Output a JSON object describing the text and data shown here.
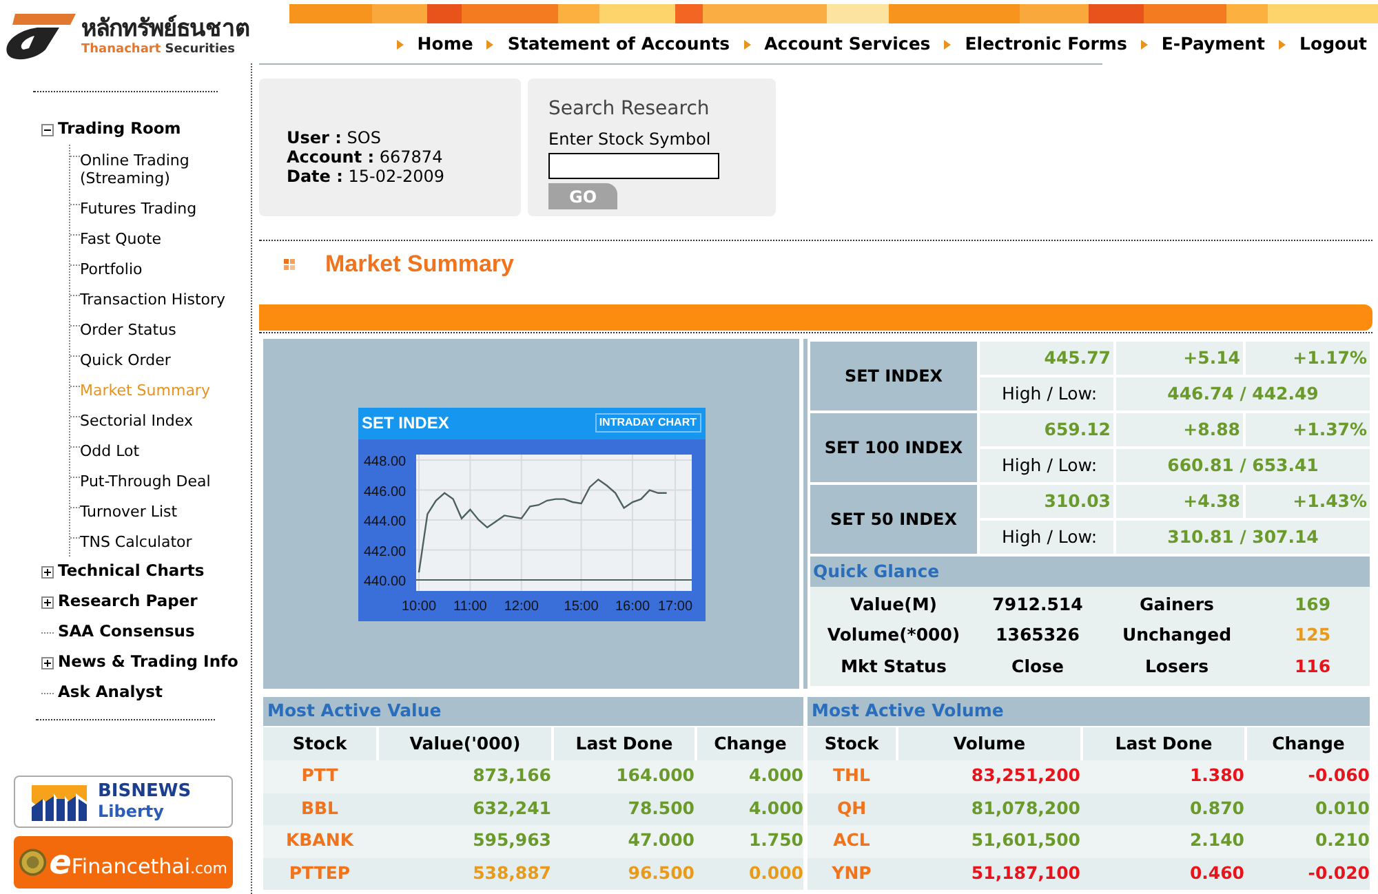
{
  "logo": {
    "thai": "หลักทรัพย์ธนชาต",
    "brand": "Thanachart",
    "suffix": "Securities"
  },
  "nav": [
    "Home",
    "Statement of Accounts",
    "Account Services",
    "Electronic Forms",
    "E-Payment",
    "Logout"
  ],
  "sidebar": {
    "items": [
      {
        "label": "Trading Room",
        "kind": "folder",
        "expanded": true,
        "children": [
          {
            "label": "Online Trading (Streaming)",
            "selected": false
          },
          {
            "label": "Futures Trading",
            "selected": false
          },
          {
            "label": "Fast Quote",
            "selected": false
          },
          {
            "label": "Portfolio",
            "selected": false
          },
          {
            "label": "Transaction History",
            "selected": false
          },
          {
            "label": "Order Status",
            "selected": false
          },
          {
            "label": "Quick Order",
            "selected": false
          },
          {
            "label": "Market Summary",
            "selected": true
          },
          {
            "label": "Sectorial Index",
            "selected": false
          },
          {
            "label": "Odd Lot",
            "selected": false
          },
          {
            "label": "Put-Through Deal",
            "selected": false
          },
          {
            "label": "Turnover List",
            "selected": false
          },
          {
            "label": "TNS Calculator",
            "selected": false
          }
        ]
      },
      {
        "label": "Technical Charts",
        "kind": "folder",
        "expanded": false
      },
      {
        "label": "Research Paper",
        "kind": "folder",
        "expanded": false
      },
      {
        "label": "SAA Consensus",
        "kind": "link"
      },
      {
        "label": "News & Trading Info",
        "kind": "folder",
        "expanded": false
      },
      {
        "label": "Ask Analyst",
        "kind": "link"
      }
    ]
  },
  "ads": {
    "bisnews": {
      "title": "BISNEWS",
      "subtitle": "Liberty"
    },
    "efinance": {
      "initial": "e",
      "name": "Financethai",
      "domain": ".com"
    }
  },
  "account": [
    {
      "label": "User :",
      "value": "SOS"
    },
    {
      "label": "Account :",
      "value": "667874"
    },
    {
      "label": "Date :",
      "value": "15-02-2009"
    }
  ],
  "search": {
    "title": "Search Research",
    "label": "Enter Stock Symbol",
    "button": "GO"
  },
  "page_title": "Market Summary",
  "chart": {
    "badge": "INTRADAY CHART",
    "chart_data": {
      "type": "line",
      "title": "SET INDEX",
      "categories": [
        "10:00",
        null,
        null,
        null,
        null,
        null,
        "11:00",
        null,
        null,
        null,
        null,
        null,
        "12:00",
        null,
        null,
        null,
        null,
        null,
        null,
        "15:00",
        null,
        null,
        null,
        null,
        null,
        "16:00",
        null,
        null,
        null,
        null,
        "17:00"
      ],
      "grid": true,
      "series": [
        {
          "color": "#4d6060",
          "values": [
            440.5,
            444.4,
            445.3,
            445.8,
            445.4,
            444.1,
            444.7,
            444.0,
            443.5,
            443.9,
            444.3,
            444.2,
            444.1,
            444.9,
            445.0,
            445.3,
            445.4,
            445.4,
            445.2,
            445.1,
            446.2,
            446.7,
            446.3,
            445.8,
            444.8,
            445.2,
            445.4,
            446.0,
            445.8,
            445.8,
            null
          ]
        }
      ],
      "ylim": [
        440,
        448
      ],
      "yticks": [
        {
          "value": 440,
          "label": "440.00"
        },
        {
          "value": 442,
          "label": "442.00"
        },
        {
          "value": 444,
          "label": "444.00"
        },
        {
          "value": 446,
          "label": "446.00"
        },
        {
          "value": 448,
          "label": "448.00"
        }
      ]
    }
  },
  "indices": [
    {
      "name": "SET INDEX",
      "last": "445.77",
      "change": "+5.14",
      "percent": "+1.17%",
      "hl_label": "High / Low:",
      "high_low": "446.74 / 442.49"
    },
    {
      "name": "SET 100 INDEX",
      "last": "659.12",
      "change": "+8.88",
      "percent": "+1.37%",
      "hl_label": "High / Low:",
      "high_low": "660.81 / 653.41"
    },
    {
      "name": "SET 50 INDEX",
      "last": "310.03",
      "change": "+4.38",
      "percent": "+1.43%",
      "hl_label": "High / Low:",
      "high_low": "310.81 / 307.14"
    }
  ],
  "quick_glance": {
    "title": "Quick Glance",
    "rows": [
      {
        "label": "Value(M)",
        "value": "7912.514",
        "stat_label": "Gainers",
        "stat_value": "169",
        "color": "#6b9a2c"
      },
      {
        "label": "Volume(*000)",
        "value": "1365326",
        "stat_label": "Unchanged",
        "stat_value": "125",
        "color": "#e89a1c"
      },
      {
        "label": "Mkt Status",
        "value": "Close",
        "stat_label": "Losers",
        "stat_value": "116",
        "color": "#e8141c"
      }
    ]
  },
  "most_active_value": {
    "title": "Most Active Value",
    "columns": [
      "Stock",
      "Value('000)",
      "Last Done",
      "Change"
    ],
    "rows": [
      {
        "cells": [
          "PTT",
          "873,166",
          "164.000",
          "4.000"
        ],
        "color": "#6b9a2c"
      },
      {
        "cells": [
          "BBL",
          "632,241",
          "78.500",
          "4.000"
        ],
        "color": "#6b9a2c"
      },
      {
        "cells": [
          "KBANK",
          "595,963",
          "47.000",
          "1.750"
        ],
        "color": "#6b9a2c"
      },
      {
        "cells": [
          "PTTEP",
          "538,887",
          "96.500",
          "0.000"
        ],
        "color": "#e89a1c"
      }
    ]
  },
  "most_active_volume": {
    "title": "Most Active Volume",
    "columns": [
      "Stock",
      "Volume",
      "Last Done",
      "Change"
    ],
    "rows": [
      {
        "cells": [
          "THL",
          "83,251,200",
          "1.380",
          "-0.060"
        ],
        "color": "#e8141c"
      },
      {
        "cells": [
          "QH",
          "81,078,200",
          "0.870",
          "0.010"
        ],
        "color": "#6b9a2c"
      },
      {
        "cells": [
          "ACL",
          "51,601,500",
          "2.140",
          "0.210"
        ],
        "color": "#6b9a2c"
      },
      {
        "cells": [
          "YNP",
          "51,187,100",
          "0.460",
          "-0.020"
        ],
        "color": "#e8141c"
      }
    ]
  }
}
